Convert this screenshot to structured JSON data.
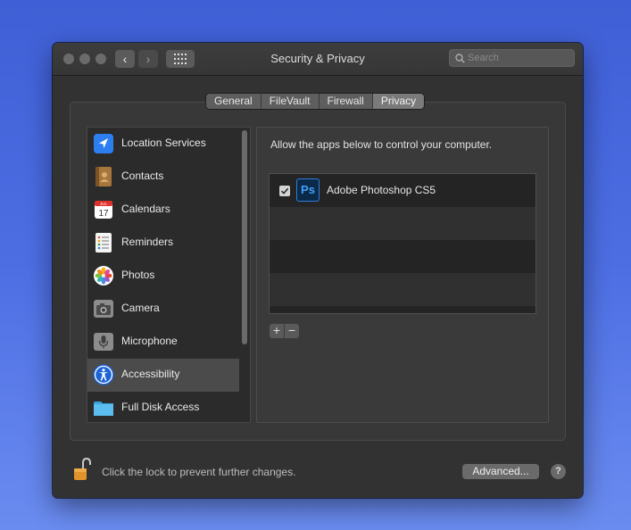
{
  "window": {
    "title": "Security & Privacy"
  },
  "toolbar": {
    "back_label": "‹",
    "forward_label": "›",
    "search_placeholder": "Search"
  },
  "tabs": [
    {
      "label": "General"
    },
    {
      "label": "FileVault"
    },
    {
      "label": "Firewall"
    },
    {
      "label": "Privacy",
      "active": true
    }
  ],
  "sidebar": {
    "items": [
      {
        "label": "Location Services",
        "icon": "location-arrow-icon"
      },
      {
        "label": "Contacts",
        "icon": "contacts-book-icon"
      },
      {
        "label": "Calendars",
        "icon": "calendar-icon",
        "icon_month": "JUL",
        "icon_day": "17"
      },
      {
        "label": "Reminders",
        "icon": "reminders-list-icon"
      },
      {
        "label": "Photos",
        "icon": "photos-flower-icon"
      },
      {
        "label": "Camera",
        "icon": "camera-icon"
      },
      {
        "label": "Microphone",
        "icon": "microphone-icon"
      },
      {
        "label": "Accessibility",
        "icon": "accessibility-icon",
        "selected": true
      },
      {
        "label": "Full Disk Access",
        "icon": "folder-icon"
      }
    ]
  },
  "main": {
    "description": "Allow the apps below to control your computer.",
    "apps": [
      {
        "name": "Adobe Photoshop CS5",
        "checked": true,
        "icon": "photoshop-icon",
        "icon_text": "Ps"
      }
    ],
    "add_label": "+",
    "remove_label": "−"
  },
  "footer": {
    "lock_text": "Click the lock to prevent further changes.",
    "advanced_label": "Advanced...",
    "help_label": "?"
  },
  "colors": {
    "desktop": "#4d6ee3",
    "window": "#323232",
    "selected_row": "#4b4b4b",
    "accent_blue": "#2f7fd6"
  }
}
